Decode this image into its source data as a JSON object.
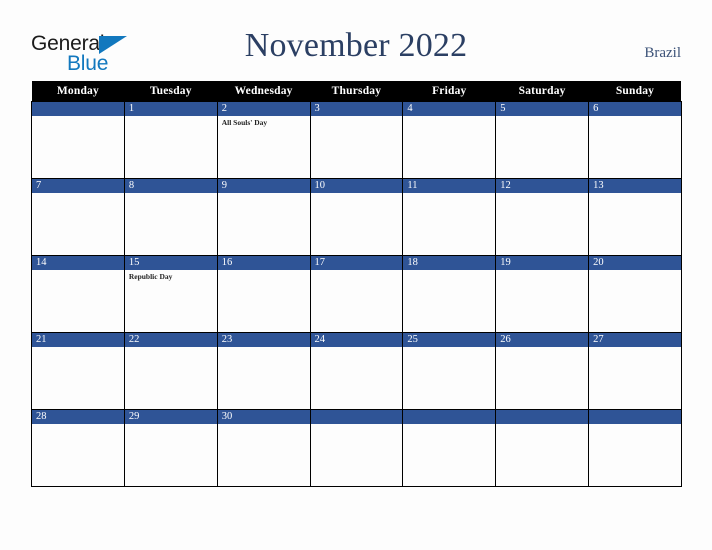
{
  "brand": {
    "name_part1": "General",
    "name_part2": "Blue",
    "triangle_icon": "triangle-icon",
    "color_primary": "#1278be",
    "color_text": "#1b1b1b"
  },
  "header": {
    "title": "November 2022",
    "country": "Brazil",
    "title_color": "#2b3f63"
  },
  "calendar": {
    "weekday_headers": [
      "Monday",
      "Tuesday",
      "Wednesday",
      "Thursday",
      "Friday",
      "Saturday",
      "Sunday"
    ],
    "header_bg": "#000000",
    "date_bar_bg": "#2f5496",
    "cell_bg": "#fdfdfd",
    "weeks": [
      [
        {
          "date": "",
          "events": []
        },
        {
          "date": "1",
          "events": []
        },
        {
          "date": "2",
          "events": [
            "All Souls' Day"
          ]
        },
        {
          "date": "3",
          "events": []
        },
        {
          "date": "4",
          "events": []
        },
        {
          "date": "5",
          "events": []
        },
        {
          "date": "6",
          "events": []
        }
      ],
      [
        {
          "date": "7",
          "events": []
        },
        {
          "date": "8",
          "events": []
        },
        {
          "date": "9",
          "events": []
        },
        {
          "date": "10",
          "events": []
        },
        {
          "date": "11",
          "events": []
        },
        {
          "date": "12",
          "events": []
        },
        {
          "date": "13",
          "events": []
        }
      ],
      [
        {
          "date": "14",
          "events": []
        },
        {
          "date": "15",
          "events": [
            "Republic Day"
          ]
        },
        {
          "date": "16",
          "events": []
        },
        {
          "date": "17",
          "events": []
        },
        {
          "date": "18",
          "events": []
        },
        {
          "date": "19",
          "events": []
        },
        {
          "date": "20",
          "events": []
        }
      ],
      [
        {
          "date": "21",
          "events": []
        },
        {
          "date": "22",
          "events": []
        },
        {
          "date": "23",
          "events": []
        },
        {
          "date": "24",
          "events": []
        },
        {
          "date": "25",
          "events": []
        },
        {
          "date": "26",
          "events": []
        },
        {
          "date": "27",
          "events": []
        }
      ],
      [
        {
          "date": "28",
          "events": []
        },
        {
          "date": "29",
          "events": []
        },
        {
          "date": "30",
          "events": []
        },
        {
          "date": "",
          "events": []
        },
        {
          "date": "",
          "events": []
        },
        {
          "date": "",
          "events": []
        },
        {
          "date": "",
          "events": []
        }
      ]
    ]
  }
}
